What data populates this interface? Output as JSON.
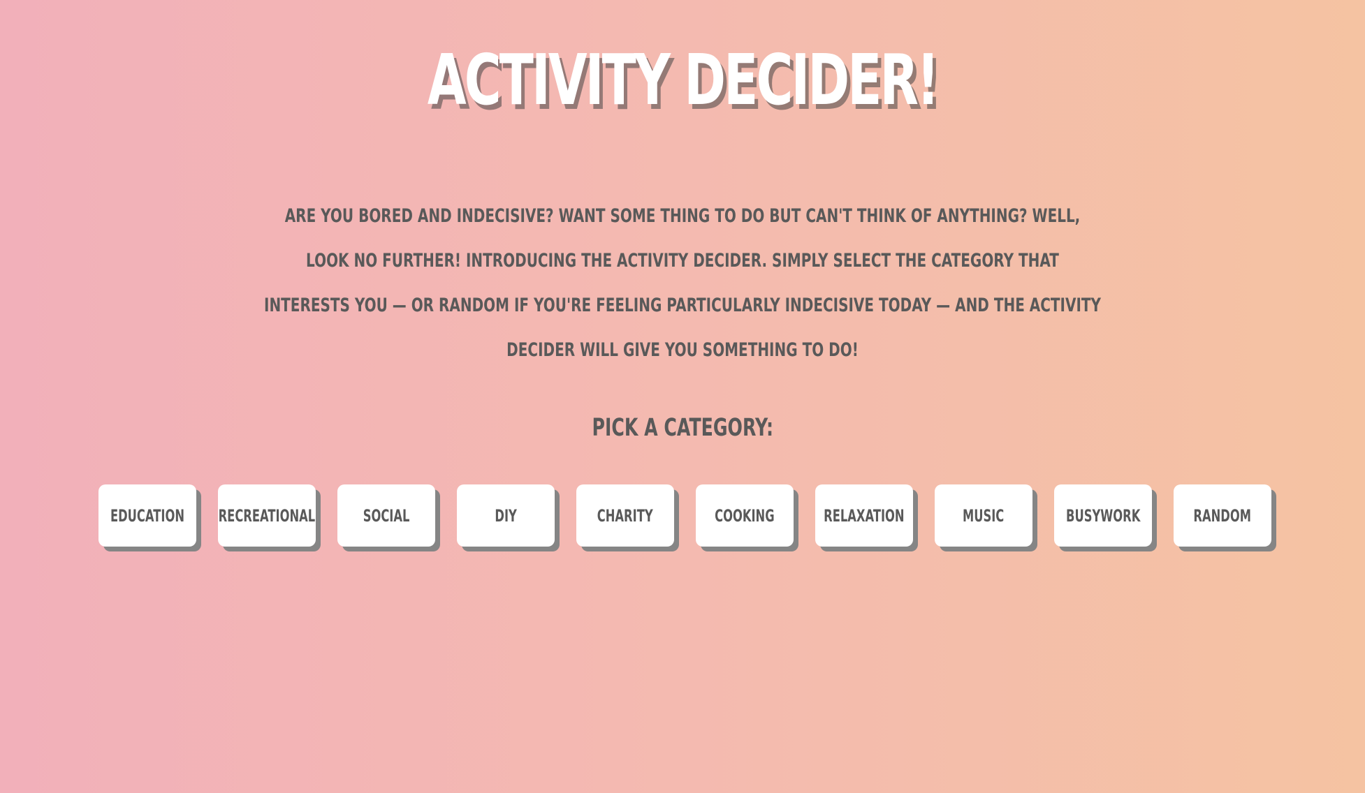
{
  "header": {
    "title": "ACTIVITY DECIDER!"
  },
  "intro": {
    "text": "ARE YOU BORED AND INDECISIVE? WANT SOME THING TO DO BUT CAN'T THINK OF ANYTHING? WELL, LOOK NO FURTHER! INTRODUCING THE ACTIVITY DECIDER. SIMPLY SELECT THE CATEGORY THAT INTERESTS YOU — OR RANDOM IF YOU'RE FEELING PARTICULARLY INDECISIVE TODAY — AND THE ACTIVITY DECIDER WILL GIVE YOU SOMETHING TO DO!"
  },
  "category_prompt": "PICK A CATEGORY:",
  "categories": [
    "EDUCATION",
    "RECREATIONAL",
    "SOCIAL",
    "DIY",
    "CHARITY",
    "COOKING",
    "RELAXATION",
    "MUSIC",
    "BUSYWORK",
    "RANDOM"
  ],
  "colors": {
    "gradient_start": "#f2b0ba",
    "gradient_end": "#f5c3a2",
    "text": "#595959",
    "button_bg": "#ffffff",
    "button_shadow": "#858585"
  }
}
